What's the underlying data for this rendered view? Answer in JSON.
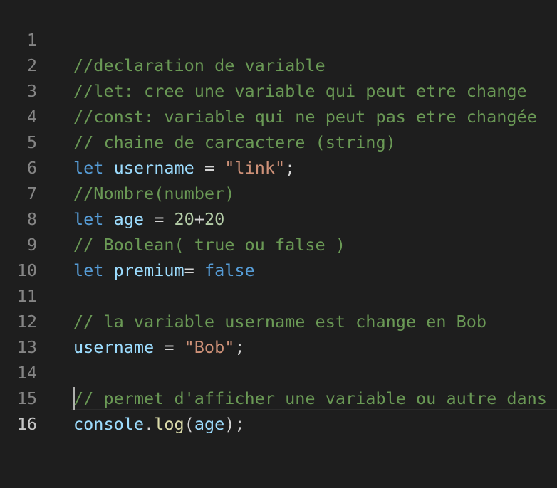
{
  "editor": {
    "colors": {
      "background": "#1e1e1e",
      "comment": "#6a9955",
      "keyword": "#569cd6",
      "variable": "#9cdcfe",
      "string": "#ce9178",
      "number": "#b5cea8",
      "function": "#dcdcaa",
      "text": "#d4d4d4",
      "line_number": "#858585"
    },
    "lines": [
      {
        "num": "1",
        "t": [
          "//declaration de variable"
        ]
      },
      {
        "num": "2",
        "t": [
          "//let: cree une variable qui peut etre change"
        ]
      },
      {
        "num": "3",
        "t": [
          "//const: variable qui ne peut pas etre changée"
        ]
      },
      {
        "num": "4",
        "t": [
          "// chaine de carcactere (string)"
        ]
      },
      {
        "num": "5",
        "t": [
          "let",
          " ",
          "username",
          " = ",
          "\"link\"",
          ";"
        ]
      },
      {
        "num": "6",
        "t": [
          "//Nombre(number)"
        ]
      },
      {
        "num": "7",
        "t": [
          "let",
          " ",
          "age",
          " = ",
          "20",
          "+",
          "20"
        ]
      },
      {
        "num": "8",
        "t": [
          "// Boolean( true ou false )"
        ]
      },
      {
        "num": "9",
        "t": [
          "let",
          " ",
          "premium",
          "= ",
          "false"
        ]
      },
      {
        "num": "10",
        "t": [
          ""
        ]
      },
      {
        "num": "11",
        "t": [
          "// la variable username est change en Bob"
        ]
      },
      {
        "num": "12",
        "t": [
          "username",
          " = ",
          "\"Bob\"",
          ";"
        ]
      },
      {
        "num": "13",
        "t": [
          ""
        ]
      },
      {
        "num": "14",
        "t": [
          "// permet d'afficher une variable ou autre dans"
        ]
      },
      {
        "num": "15",
        "t": [
          "console",
          ".",
          "log",
          "(",
          "age",
          ");"
        ]
      },
      {
        "num": "16",
        "t": [
          ""
        ]
      }
    ]
  }
}
